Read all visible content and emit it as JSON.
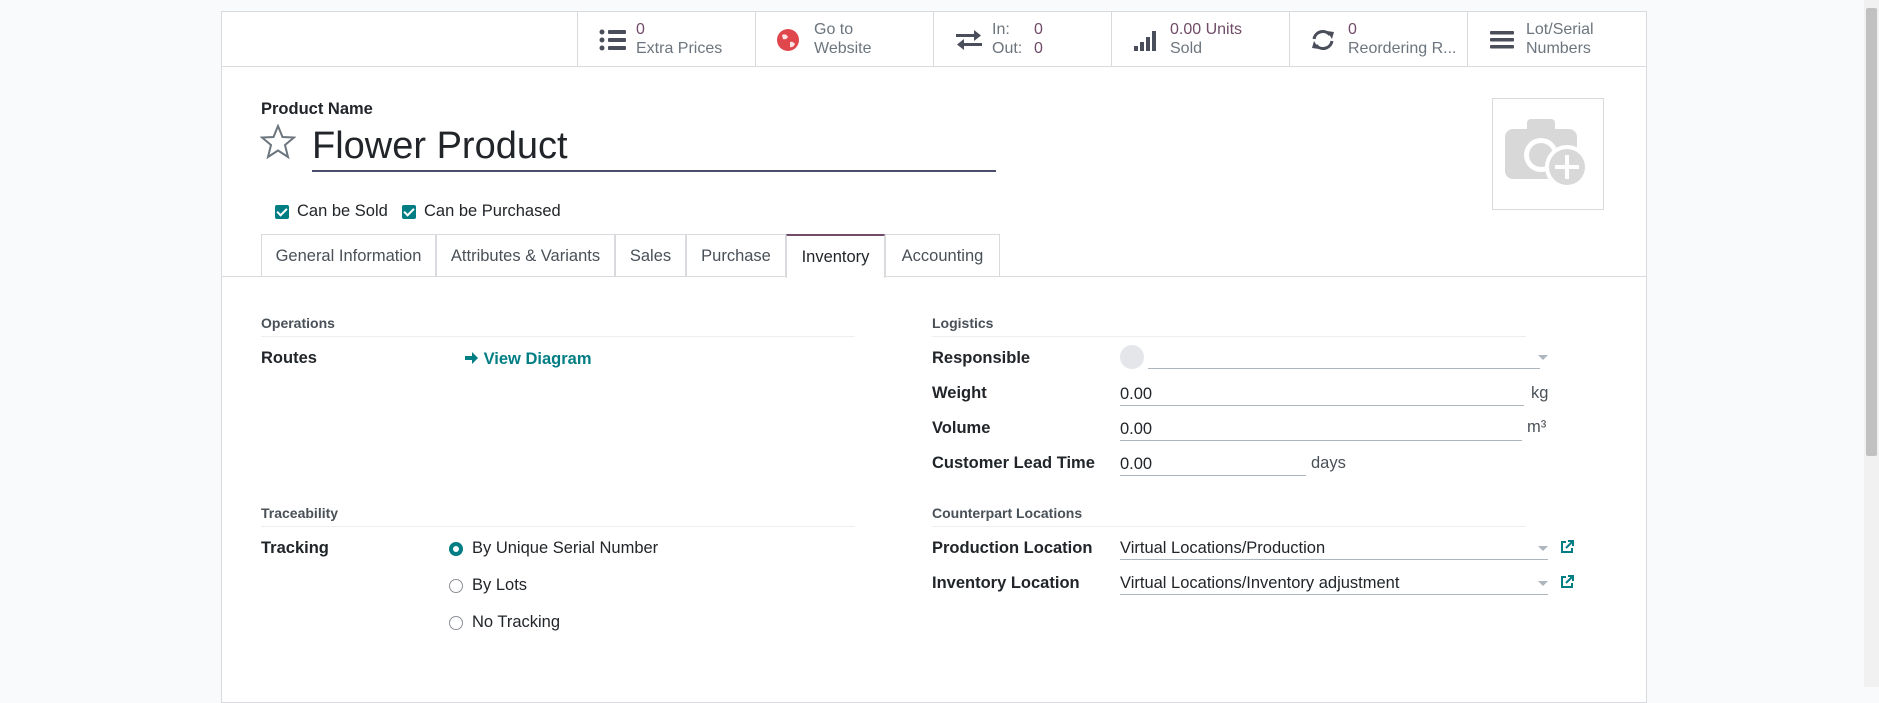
{
  "smart_buttons": {
    "extra_prices": {
      "value": "0",
      "label": "Extra Prices"
    },
    "website": {
      "line1": "Go to",
      "line2": "Website"
    },
    "in_out": {
      "in_label": "In:",
      "in_value": "0",
      "out_label": "Out:",
      "out_value": "0"
    },
    "sold": {
      "value": "0.00 Units",
      "label": "Sold"
    },
    "reordering": {
      "value": "0",
      "label": "Reordering R..."
    },
    "lots": {
      "line1": "Lot/Serial",
      "line2": "Numbers"
    }
  },
  "product": {
    "name_label": "Product Name",
    "name": "Flower Product",
    "can_be_sold": "Can be Sold",
    "can_be_purchased": "Can be Purchased"
  },
  "tabs": [
    "General Information",
    "Attributes & Variants",
    "Sales",
    "Purchase",
    "Inventory",
    "Accounting"
  ],
  "active_tab": "Inventory",
  "operations": {
    "title": "Operations",
    "routes_label": "Routes",
    "view_diagram": "View Diagram"
  },
  "logistics": {
    "title": "Logistics",
    "responsible_label": "Responsible",
    "weight_label": "Weight",
    "weight_value": "0.00",
    "weight_unit": "kg",
    "volume_label": "Volume",
    "volume_value": "0.00",
    "volume_unit": "m³",
    "lead_time_label": "Customer Lead Time",
    "lead_time_value": "0.00",
    "lead_time_unit": "days"
  },
  "traceability": {
    "title": "Traceability",
    "tracking_label": "Tracking",
    "options": [
      "By Unique Serial Number",
      "By Lots",
      "No Tracking"
    ],
    "selected": "By Unique Serial Number"
  },
  "counterpart": {
    "title": "Counterpart Locations",
    "production_label": "Production Location",
    "production_value": "Virtual Locations/Production",
    "inventory_label": "Inventory Location",
    "inventory_value": "Virtual Locations/Inventory adjustment"
  },
  "colors": {
    "accent": "#714b67",
    "primary": "#017e84"
  }
}
